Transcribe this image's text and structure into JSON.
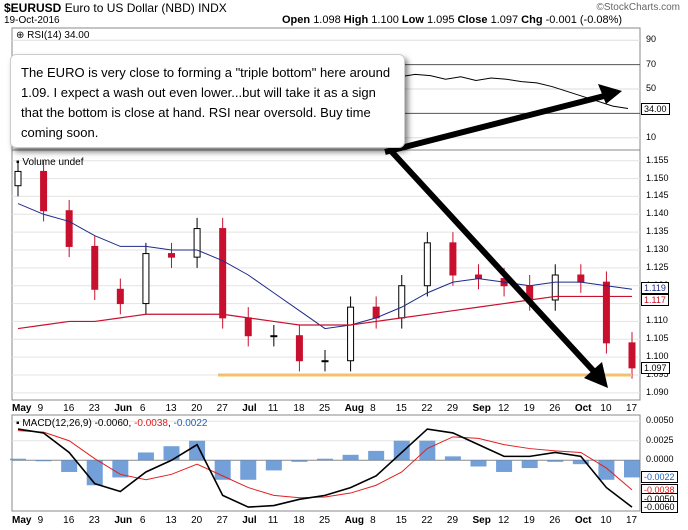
{
  "header": {
    "symbol": "$EURUSD",
    "name": "Euro to US Dollar (NBD)",
    "exchange": "INDX",
    "date": "19-Oct-2016",
    "open_label": "Open",
    "open": "1.098",
    "high_label": "High",
    "high": "1.100",
    "low_label": "Low",
    "low": "1.095",
    "close_label": "Close",
    "close": "1.097",
    "chg_label": "Chg",
    "chg": "-0.001 (-0.08%)",
    "brand": "©StockCharts.com"
  },
  "rsi_panel": {
    "title": "RSI(14) 34.00",
    "ticks": [
      "90",
      "70",
      "50",
      "30",
      "10"
    ],
    "current_label": "34.00"
  },
  "price_panel": {
    "volume_label": "Volume undef",
    "ticks": [
      "1.155",
      "1.150",
      "1.145",
      "1.140",
      "1.135",
      "1.130",
      "1.125",
      "1.120",
      "1.115",
      "1.110",
      "1.105",
      "1.100",
      "1.095",
      "1.090"
    ],
    "price_box": "1.097",
    "ma1_box": "1.119",
    "ma2_box": "1.117"
  },
  "macd_panel": {
    "title_prefix": "MACD(12,26,9)",
    "macd_value": "-0.0060",
    "signal_value": "-0.0038",
    "hist_value": "-0.0022",
    "ticks": [
      "0.0050",
      "0.0025",
      "0.0000"
    ],
    "boxes": [
      "-0.0022",
      "-0.0038",
      "-0.0050",
      "-0.0060"
    ]
  },
  "x_axis": {
    "labels": [
      "May",
      "9",
      "16",
      "23",
      "Jun",
      "6",
      "13",
      "20",
      "27",
      "Jul",
      "11",
      "18",
      "25",
      "Aug",
      "8",
      "15",
      "22",
      "29",
      "Sep",
      "12",
      "19",
      "26",
      "Oct",
      "10",
      "17"
    ],
    "bold": [
      "May",
      "Jun",
      "Jul",
      "Aug",
      "Sep",
      "Oct"
    ]
  },
  "note": {
    "text": "The EURO is very close to forming a \"triple bottom\" here around 1.09. I expect a wash out even lower...but will take it as a sign that the bottom is close at hand. RSI near oversold. Buy time coming soon."
  },
  "colors": {
    "up": "#000000",
    "down": "#c8102e",
    "ma_long": "#c8102e",
    "ma_short": "#1f2a8a",
    "support": "#f5c06b",
    "hist": "#5b8fd1",
    "macd": "#000000",
    "signal": "#e02020"
  },
  "chart_data": [
    {
      "type": "line",
      "panel": "RSI",
      "title": "RSI(14) 34.00",
      "ylim": [
        0,
        100
      ],
      "ticks": [
        90,
        70,
        50,
        30,
        10
      ],
      "series": [
        {
          "name": "RSI(14)",
          "values": [
            60,
            62,
            61,
            58,
            60,
            57,
            59,
            58,
            56,
            55,
            52,
            48,
            44,
            40,
            36,
            34
          ]
        }
      ]
    },
    {
      "type": "line",
      "panel": "Price",
      "title": "$EURUSD",
      "ylim": [
        1.088,
        1.158
      ],
      "x": [
        "May 2",
        "May 9",
        "May 16",
        "May 23",
        "May 30",
        "Jun 6",
        "Jun 13",
        "Jun 20",
        "Jun 27",
        "Jul 4",
        "Jul 11",
        "Jul 18",
        "Jul 25",
        "Aug 1",
        "Aug 8",
        "Aug 15",
        "Aug 22",
        "Aug 29",
        "Sep 5",
        "Sep 12",
        "Sep 19",
        "Sep 26",
        "Oct 3",
        "Oct 10",
        "Oct 17"
      ],
      "series": [
        {
          "name": "$EURUSD",
          "values": [
            1.152,
            1.141,
            1.131,
            1.119,
            1.115,
            1.129,
            1.128,
            1.136,
            1.111,
            1.106,
            1.106,
            1.099,
            1.099,
            1.114,
            1.111,
            1.12,
            1.132,
            1.123,
            1.122,
            1.12,
            1.116,
            1.123,
            1.121,
            1.104,
            1.097
          ]
        },
        {
          "values": [
            1.143,
            1.14,
            1.138,
            1.134,
            1.131,
            1.131,
            1.13,
            1.13,
            1.127,
            1.123,
            1.118,
            1.113,
            1.108,
            1.109,
            1.111,
            1.114,
            1.118,
            1.121,
            1.122,
            1.121,
            1.12,
            1.121,
            1.121,
            1.12,
            1.119
          ]
        },
        {
          "values": [
            1.108,
            1.109,
            1.11,
            1.11,
            1.111,
            1.112,
            1.112,
            1.112,
            1.112,
            1.111,
            1.11,
            1.109,
            1.109,
            1.109,
            1.11,
            1.111,
            1.112,
            1.113,
            1.114,
            1.115,
            1.116,
            1.117,
            1.117,
            1.117,
            1.117
          ]
        },
        {
          "values": [
            1.095,
            1.095
          ]
        }
      ]
    },
    {
      "type": "line",
      "panel": "MACD",
      "title": "MACD(12,26,9) -0.0060, -0.0038, -0.0022",
      "ylim": [
        -0.0065,
        0.0058
      ],
      "ticks": [
        0.005,
        0.0025,
        0.0
      ],
      "series": [
        {
          "name": "MACD",
          "values": [
            0.004,
            0.0035,
            0.001,
            -0.003,
            -0.004,
            -0.0015,
            0.0,
            0.002,
            -0.0045,
            -0.006,
            -0.0058,
            -0.005,
            -0.0045,
            -0.0035,
            -0.002,
            0.001,
            0.004,
            0.0035,
            0.002,
            0.0005,
            0.0005,
            0.001,
            0.0005,
            -0.0035,
            -0.006
          ]
        },
        {
          "name": "Signal",
          "values": [
            0.0038,
            0.0036,
            0.0025,
            0.0002,
            -0.0018,
            -0.0025,
            -0.0018,
            -0.0005,
            -0.002,
            -0.0035,
            -0.0045,
            -0.0048,
            -0.0047,
            -0.0042,
            -0.0032,
            -0.0015,
            0.0015,
            0.003,
            0.0028,
            0.002,
            0.0015,
            0.0012,
            0.001,
            -0.001,
            -0.0038
          ]
        },
        {
          "name": "Histogram",
          "values": [
            0.0002,
            -0.0001,
            -0.0015,
            -0.0032,
            -0.0022,
            0.001,
            0.0018,
            0.0025,
            -0.0025,
            -0.0025,
            -0.0013,
            -0.0002,
            0.0002,
            0.0007,
            0.0012,
            0.0025,
            0.0025,
            0.0005,
            -0.0008,
            -0.0015,
            -0.001,
            -0.0002,
            -0.0005,
            -0.0025,
            -0.0022
          ]
        }
      ]
    }
  ]
}
